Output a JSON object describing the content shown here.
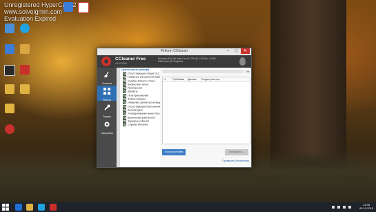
{
  "desktop": {
    "watermark": [
      "Unregistered HyperCam 2",
      "www.solveigmm.com",
      "Evaluation Expired"
    ],
    "icons": [
      {
        "name": "computer-icon",
        "color": "#4a90d9"
      },
      {
        "name": "skype-icon",
        "color": "#1fa3e0"
      },
      {
        "name": "monitor-icon",
        "color": "#3b7dd8"
      },
      {
        "name": "archive-icon",
        "color": "#d9a441"
      },
      {
        "name": "document-icon",
        "color": "#cfcfcf"
      },
      {
        "name": "pdf-icon",
        "color": "#c9302c"
      },
      {
        "name": "folder-icon",
        "color": "#e0b341"
      },
      {
        "name": "text-icon",
        "color": "#e0b341"
      },
      {
        "name": "folder-icon",
        "color": "#e0b341"
      },
      {
        "name": "app-icon",
        "color": "#c9302c"
      }
    ]
  },
  "window": {
    "title": "Piriform CCleaner",
    "app_name": "CCleaner Free",
    "version": "v5.07.5261",
    "sysinfo": "Windows 8 64-bit\nIntel Core i3 CPU @ 2.40GHz, 4.0GB RAM, Intel HD Graphics",
    "controls": {
      "min": "–",
      "max": "□",
      "close": "✕"
    }
  },
  "sidebar": {
    "items": [
      {
        "label": "Очистка",
        "icon": "broom-icon",
        "active": false
      },
      {
        "label": "Реестр",
        "icon": "registry-icon",
        "active": true
      },
      {
        "label": "Сервис",
        "icon": "wrench-icon",
        "active": false
      },
      {
        "label": "Настройки",
        "icon": "gear-icon",
        "active": false
      }
    ]
  },
  "tree": {
    "header": "Целостность реестра",
    "items": [
      "Отсутствующие общие DLL",
      "Неверные расширения файлов",
      "Ошибки ActiveX и Class",
      "Библиотеки типов",
      "Приложения",
      "Шрифты",
      "Пути приложений",
      "Файлы справки",
      "Неверные записи установщика",
      "Отсутствующие приложения",
      "Автозагрузка",
      "Упорядочивание меню Пуск",
      "Временные файлы MUI",
      "Звуковые события",
      "Службы Windows"
    ]
  },
  "main": {
    "progress": 0,
    "progress_label": "0%",
    "columns": [
      "Проблема",
      "Данные",
      "Раздел реестра"
    ],
    "analyze_button": "Поиск проблем",
    "fix_button": "Исправить...",
    "update_link": "Проверить обновления"
  },
  "taskbar": {
    "clock_time": "13:45",
    "clock_date": "05.10.2015"
  }
}
